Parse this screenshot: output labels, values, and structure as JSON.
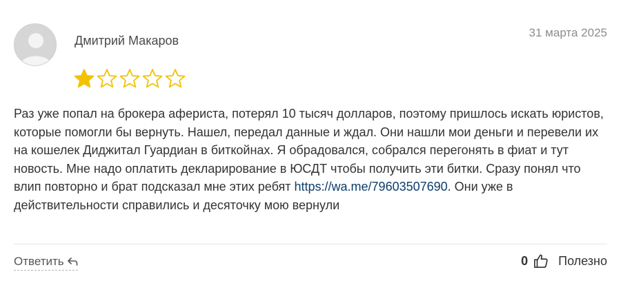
{
  "review": {
    "author": "Дмитрий Макаров",
    "date": "31 марта 2025",
    "rating": 1,
    "rating_max": 5,
    "star_color": "#f2c200",
    "text_before_link": "Раз уже попал на брокера афериста, потерял 10 тысяч долларов, поэтому пришлось искать юристов, которые помогли бы вернуть. Нашел, передал данные и ждал. Они нашли мои деньги и перевели их на кошелек Диджитал Гуардиан в биткойнах. Я обрадовался, собрался перегонять в фиат и тут новость. Мне надо оплатить декларирование в ЮСДТ чтобы получить эти битки. Сразу понял что влип повторно и брат подсказал мне этих ребят ",
    "link_text": "https://wa.me/79603507690",
    "text_after_link": ". Они уже в действительности справились и десяточку мою вернули"
  },
  "actions": {
    "reply_label": "Ответить",
    "useful_count": "0",
    "useful_label": "Полезно"
  },
  "icons": {
    "avatar": "user-avatar-placeholder",
    "star": "star-icon",
    "reply": "reply-arrow-icon",
    "thumb": "thumbs-up-icon"
  }
}
